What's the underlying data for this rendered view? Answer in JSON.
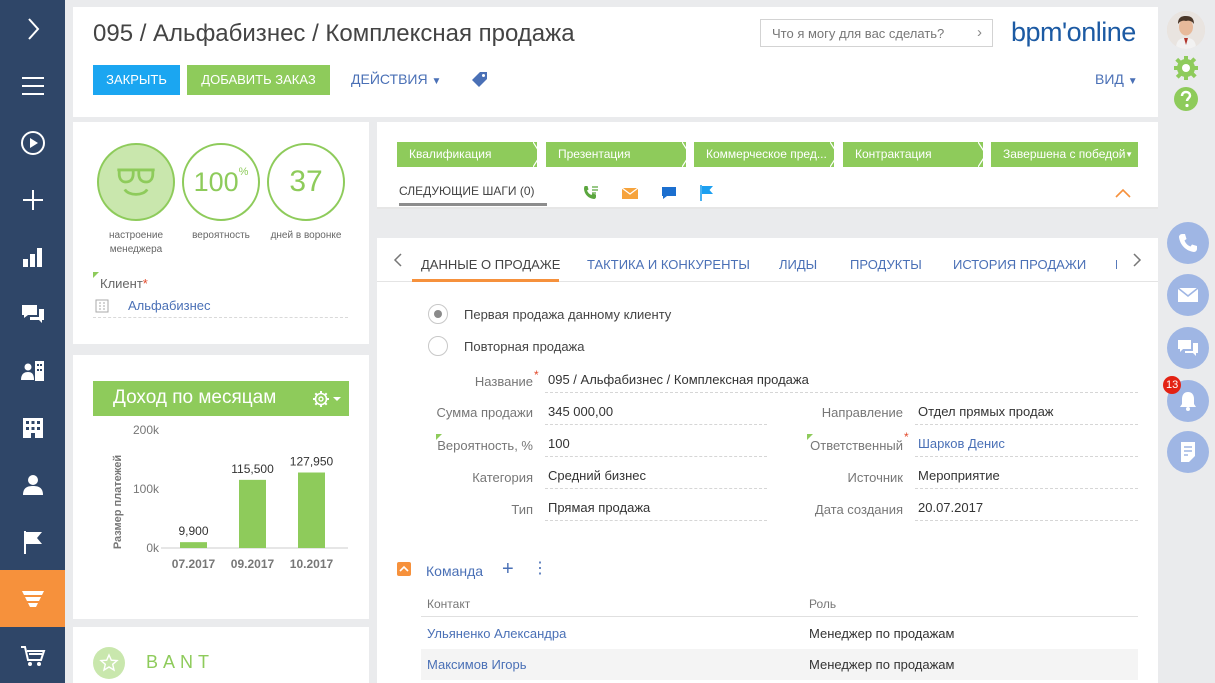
{
  "header": {
    "title": "095 / Альфабизнес / Комплексная продажа",
    "search_placeholder": "Что я могу для вас сделать?",
    "logo": "bpm'online",
    "close_label": "ЗАКРЫТЬ",
    "add_order_label": "ДОБАВИТЬ ЗАКАЗ",
    "actions_label": "ДЕЙСТВИЯ",
    "view_label": "ВИД"
  },
  "metrics": {
    "mood_label": "настроение менеджера",
    "probability_value": "100",
    "probability_unit": "%",
    "probability_label": "вероятность",
    "days_value": "37",
    "days_label": "дней в воронке",
    "client_label": "Клиент",
    "client_value": "Альфабизнес"
  },
  "chart_data": {
    "type": "bar",
    "title": "Доход по месяцам",
    "ylabel": "Размер платежей",
    "categories": [
      "07.2017",
      "09.2017",
      "10.2017"
    ],
    "values": [
      9900,
      115500,
      127950
    ],
    "value_labels": [
      "9,900",
      "115,500",
      "127,950"
    ],
    "yticks": [
      0,
      100000,
      200000
    ],
    "ytick_labels": [
      "0k",
      "100k",
      "200k"
    ],
    "ylim": [
      0,
      200000
    ],
    "color": "#8ecb5b",
    "grid": false,
    "legend": "none"
  },
  "bant": {
    "label": "BANT"
  },
  "stages": {
    "items": [
      "Квалификация",
      "Презентация",
      "Коммерческое пред...",
      "Контрактация",
      "Завершена с победой"
    ],
    "next_steps_label": "СЛЕДУЮЩИЕ ШАГИ (0)"
  },
  "tabs": {
    "items": [
      "ДАННЫЕ О ПРОДАЖЕ",
      "ТАКТИКА И КОНКУРЕНТЫ",
      "ЛИДЫ",
      "ПРОДУКТЫ",
      "ИСТОРИЯ ПРОДАЖИ",
      "ИС"
    ]
  },
  "form": {
    "radio_first": "Первая продажа данному клиенту",
    "radio_repeat": "Повторная продажа",
    "name_label": "Название",
    "name_value": "095 / Альфабизнес / Комплексная продажа",
    "amount_label": "Сумма продажи",
    "amount_value": "345 000,00",
    "direction_label": "Направление",
    "direction_value": "Отдел прямых продаж",
    "probability_label": "Вероятность, %",
    "probability_value": "100",
    "owner_label": "Ответственный",
    "owner_value": "Шарков Денис",
    "category_label": "Категория",
    "category_value": "Средний бизнес",
    "source_label": "Источник",
    "source_value": "Мероприятие",
    "type_label": "Тип",
    "type_value": "Прямая продажа",
    "created_label": "Дата создания",
    "created_value": "20.07.2017"
  },
  "team": {
    "title": "Команда",
    "columns": [
      "Контакт",
      "Роль"
    ],
    "rows": [
      {
        "contact": "Ульяненко Александра",
        "role": "Менеджер по продажам"
      },
      {
        "contact": "Максимов Игорь",
        "role": "Менеджер по продажам"
      }
    ]
  },
  "notifications": {
    "count": "13"
  },
  "icons": {
    "nav": [
      "chevron-right-icon",
      "menu-icon",
      "play-icon",
      "plus-icon",
      "bar-chart-icon",
      "chat-icon",
      "accounts-icon",
      "building-icon",
      "contact-icon",
      "flag-icon",
      "funnel-icon",
      "cart-icon"
    ]
  }
}
